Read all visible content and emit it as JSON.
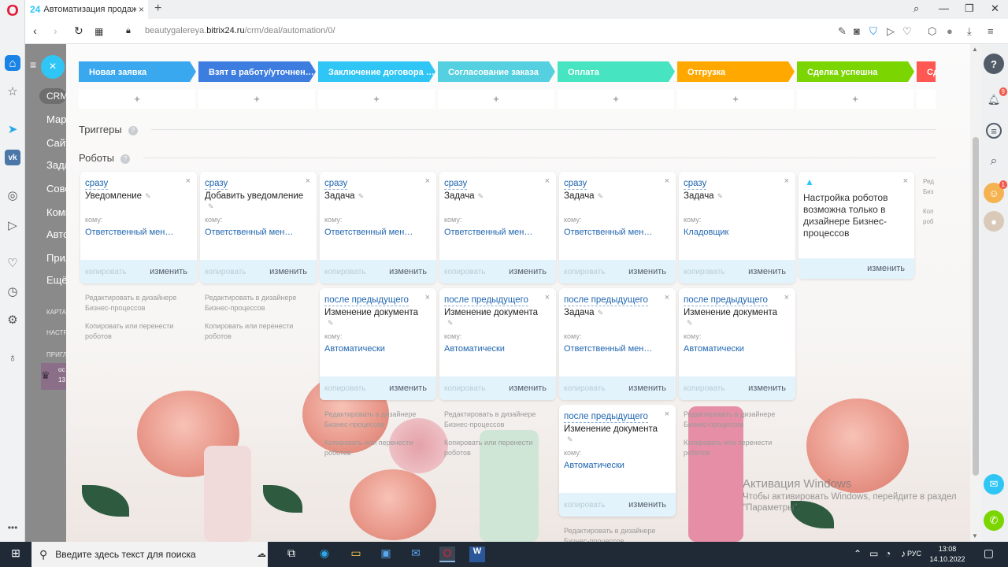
{
  "browser": {
    "tab_title": "Автоматизация продаж",
    "tab_favicon": "24",
    "url_prefix": "beautygalereya.",
    "url_domain": "bitrix24.ru",
    "url_path": "/crm/deal/automation/0/"
  },
  "left_menu": {
    "crm_badge": "CRM",
    "items": [
      "Мар",
      "Сайт",
      "Зада",
      "Сове",
      "Комп",
      "Авто",
      "Прил",
      "Ещё"
    ],
    "small_items": [
      "КАРТА",
      "НАСТР",
      "ПРИГЛ"
    ],
    "profile_line1": "ос",
    "profile_line2": "13"
  },
  "stages": [
    {
      "label": "Новая заявка",
      "color": "#39a8ef"
    },
    {
      "label": "Взят в работу/уточнен…",
      "color": "#3d7de0"
    },
    {
      "label": "Заключение договора …",
      "color": "#2fc6f6"
    },
    {
      "label": "Согласование заказа",
      "color": "#55d0e0"
    },
    {
      "label": "Оплата",
      "color": "#47e4c2"
    },
    {
      "label": "Отгрузка",
      "color": "#ffa900"
    },
    {
      "label": "Сделка успешна",
      "color": "#7bd500"
    },
    {
      "label": "Сд",
      "color": "#ff5752"
    }
  ],
  "add_symbol": "+",
  "sections": {
    "triggers": "Триггеры",
    "robots": "Роботы",
    "help": "?"
  },
  "card_labels": {
    "to": "кому:",
    "copy": "копировать",
    "edit": "изменить",
    "close": "×"
  },
  "robots_row1": [
    {
      "cond": "сразу",
      "title": "Уведомление",
      "resp": "Ответственный мен…"
    },
    {
      "cond": "сразу",
      "title": "Добавить уведомление",
      "resp": "Ответственный мен…"
    },
    {
      "cond": "сразу",
      "title": "Задача",
      "resp": "Ответственный мен…"
    },
    {
      "cond": "сразу",
      "title": "Задача",
      "resp": "Ответственный мен…"
    },
    {
      "cond": "сразу",
      "title": "Задача",
      "resp": "Ответственный мен…"
    },
    {
      "cond": "сразу",
      "title": "Задача",
      "resp": "Кладовщик"
    }
  ],
  "robots_row2": [
    {
      "cond": "после предыдущего",
      "title": "Изменение документа",
      "resp": "Автоматически"
    },
    {
      "cond": "после предыдущего",
      "title": "Изменение документа",
      "resp": "Автоматически"
    },
    {
      "cond": "после предыдущего",
      "title": "Задача",
      "resp": "Ответственный мен…"
    },
    {
      "cond": "после предыдущего",
      "title": "Изменение документа",
      "resp": "Автоматически"
    }
  ],
  "robots_row3": [
    {
      "cond": "после предыдущего",
      "title": "Изменение документа",
      "resp": "Автоматически"
    }
  ],
  "alert_card": {
    "text": "Настройка роботов возможна только в дизайнере Бизнес-процессов",
    "edit": "изменить"
  },
  "hints": {
    "designer": "Редактировать в дизайнере Бизнес-процессов",
    "copy_move": "Копировать или перенести роботов"
  },
  "right_bar": {
    "notifications_count": "1",
    "notif_small": "9",
    "cut_text": [
      "Ред",
      "Биз",
      "Коп",
      "роб"
    ]
  },
  "activation": {
    "title": "Активация Windows",
    "subtitle": "Чтобы активировать Windows, перейдите в раздел",
    "subtitle2": "\"Параметры\"."
  },
  "taskbar": {
    "search_placeholder": "Введите здесь текст для поиска",
    "lang": "РУС",
    "time": "13:08",
    "date": "14.10.2022"
  }
}
